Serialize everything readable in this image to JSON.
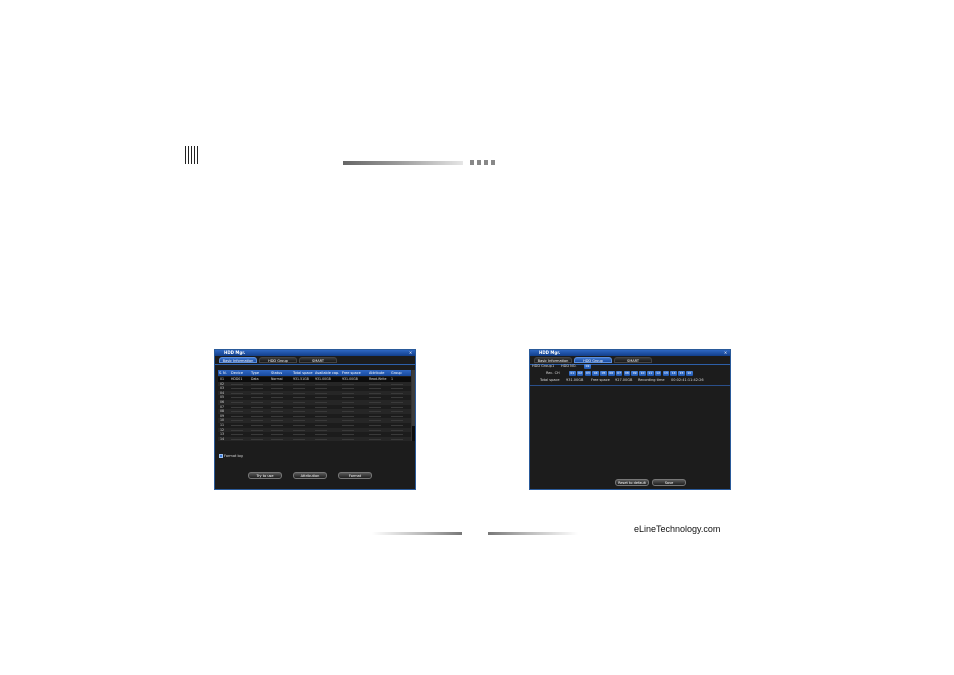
{
  "footer": {
    "brand": "eLineTechnology.com"
  },
  "dialog_left": {
    "title": "HDD Mgr.",
    "close": "×",
    "tabs": [
      {
        "label": "Basic Information",
        "active": true
      },
      {
        "label": "HDD Group",
        "active": false
      },
      {
        "label": "SMART",
        "active": false
      }
    ],
    "columns": [
      "S.",
      "N.",
      "Device",
      "Type",
      "Status",
      "Total space",
      "Available cap.",
      "Free space",
      "Attribute",
      "Group"
    ],
    "rows": [
      {
        "no": "01",
        "device": "HDD01",
        "type": "Data",
        "status": "Normal",
        "total": "931.51GB",
        "avail": "931.00GB",
        "free": "931.00GB",
        "attr": "Read-Write",
        "group": "1"
      },
      {
        "no": "02"
      },
      {
        "no": "03"
      },
      {
        "no": "04"
      },
      {
        "no": "05"
      },
      {
        "no": "06"
      },
      {
        "no": "07"
      },
      {
        "no": "08"
      },
      {
        "no": "09"
      },
      {
        "no": "10"
      },
      {
        "no": "11"
      },
      {
        "no": "12"
      },
      {
        "no": "13"
      },
      {
        "no": "14"
      }
    ],
    "format_log_label": "Format log",
    "buttons": {
      "try_to_use": "Try to use",
      "attribution": "Attribution",
      "format": "Format"
    }
  },
  "dialog_right": {
    "title": "HDD Mgr.",
    "close": "×",
    "tabs": [
      {
        "label": "Basic Information",
        "active": false
      },
      {
        "label": "HDD Group",
        "active": true
      },
      {
        "label": "SMART",
        "active": false
      }
    ],
    "group_label": "HDD Group",
    "group_value": "1",
    "hdd_no_label": "HDD NO.",
    "hdd_no_value": "01",
    "rec_ch_label": "Rec. CH",
    "channels": [
      "01",
      "02",
      "03",
      "04",
      "05",
      "06",
      "07",
      "08",
      "09",
      "10",
      "11",
      "12",
      "13",
      "14",
      "15",
      "16"
    ],
    "total_space_label": "Total space",
    "total_space_value": "931.00GB",
    "free_space_label": "Free space",
    "free_space_value": "927.00GB",
    "recording_time_label": "Recording time",
    "recording_time_value": "00:02:41:11:42:26",
    "buttons": {
      "reset_default": "Reset to default",
      "save": "Save"
    }
  }
}
